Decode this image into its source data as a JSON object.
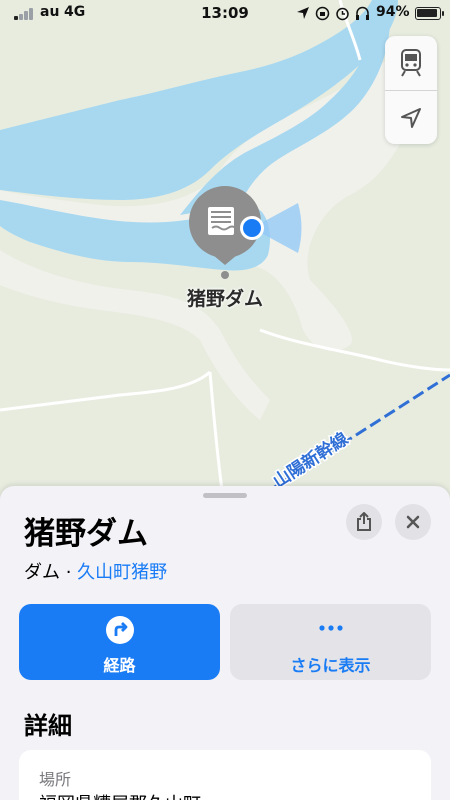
{
  "status_bar": {
    "carrier": "au",
    "network": "4G",
    "time": "13:09",
    "battery_percent_text": "94%",
    "battery_level": 0.94
  },
  "map": {
    "pin_label": "猪野ダム",
    "railway_label": "山陽新幹線",
    "colors": {
      "land": "#e7ecdf",
      "water": "#a8d8f0",
      "dam_area": "#f1f1ec",
      "rail": "#2f6fd6"
    },
    "icons": [
      "dam-icon",
      "current-location-icon",
      "transit-icon",
      "location-arrow-icon"
    ]
  },
  "sheet": {
    "title": "猪野ダム",
    "category": "ダム",
    "separator": " · ",
    "locality": "久山町猪野",
    "actions": {
      "directions_label": "経路",
      "more_label": "さらに表示"
    },
    "details_heading": "詳細",
    "address_label": "場所",
    "address_value": "福岡県糟屋郡久山町"
  },
  "colors": {
    "accent": "#1a7cf5",
    "sheet_bg": "#f2f2f7"
  }
}
